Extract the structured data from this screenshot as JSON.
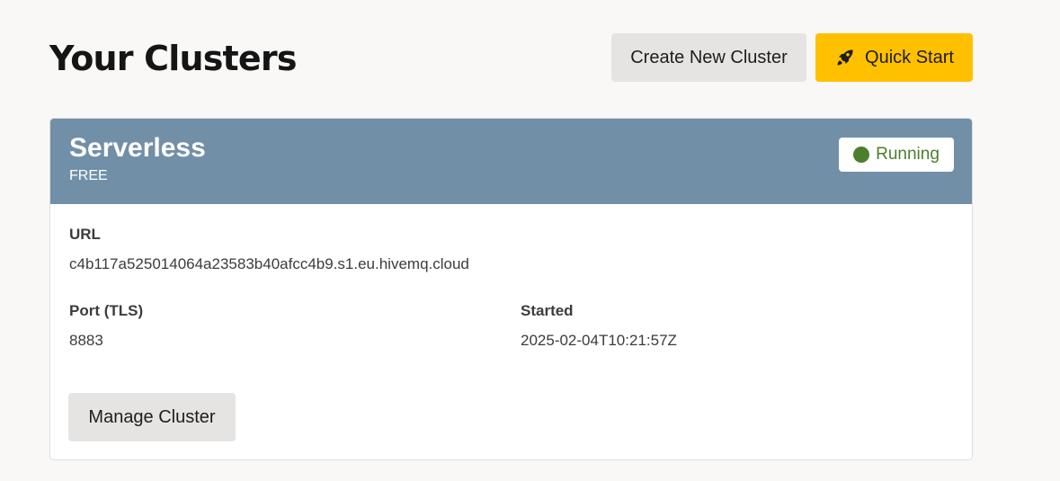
{
  "page": {
    "title": "Your Clusters"
  },
  "header_actions": {
    "create_label": "Create New Cluster",
    "quick_start_label": "Quick Start",
    "quick_start_icon": "rocket-icon",
    "quick_start_color": "#ffc000"
  },
  "cluster": {
    "name": "Serverless",
    "plan": "FREE",
    "header_color": "#7190a7",
    "status": {
      "label": "Running",
      "color": "#4b7f2a"
    },
    "url_label": "URL",
    "url_value": "c4b117a525014064a23583b40afcc4b9.s1.eu.hivemq.cloud",
    "port_label": "Port (TLS)",
    "port_value": "8883",
    "started_label": "Started",
    "started_value": "2025-02-04T10:21:57Z",
    "manage_label": "Manage Cluster"
  }
}
